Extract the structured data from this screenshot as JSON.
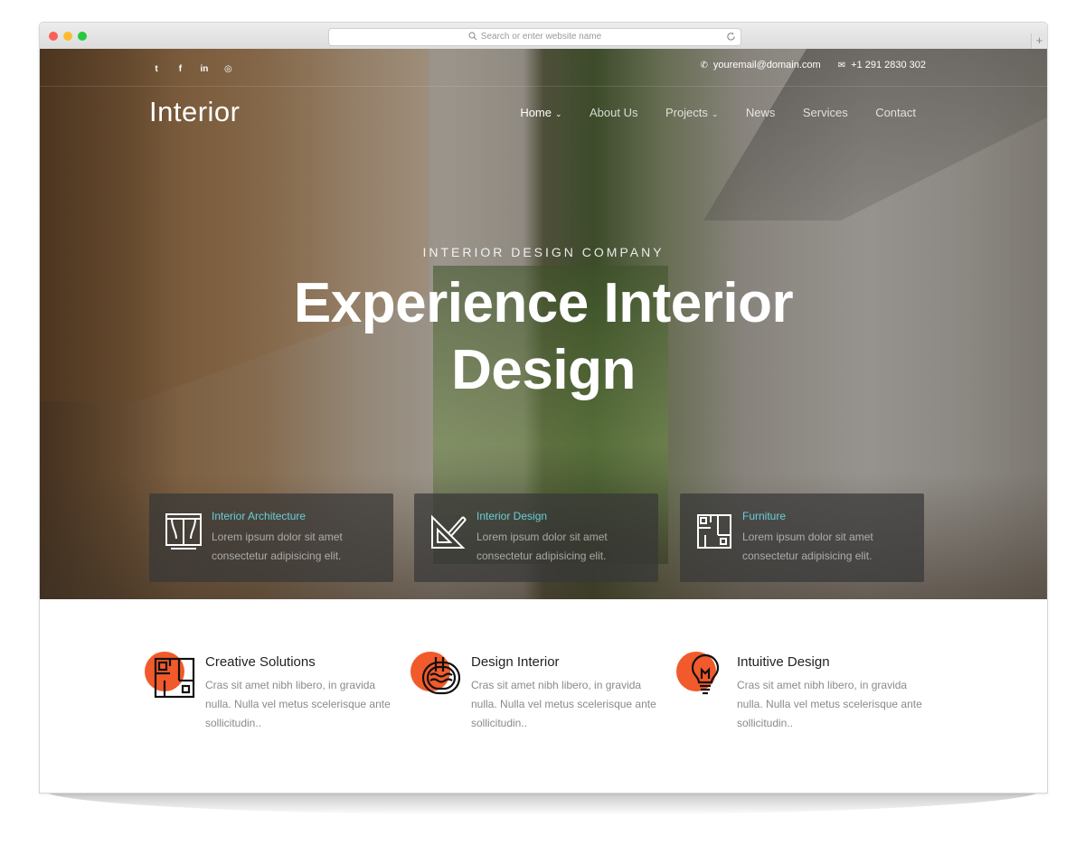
{
  "browser": {
    "address_placeholder": "Search or enter website name",
    "new_tab_label": "+"
  },
  "topbar": {
    "social": [
      {
        "icon": "twitter-icon",
        "glyph": "t"
      },
      {
        "icon": "facebook-icon",
        "glyph": "f"
      },
      {
        "icon": "linkedin-icon",
        "glyph": "in"
      },
      {
        "icon": "instagram-icon",
        "glyph": "◎"
      }
    ],
    "email": "youremail@domain.com",
    "phone": "+1 291 2830 302"
  },
  "header": {
    "logo": "Interior",
    "nav": [
      {
        "label": "Home",
        "dropdown": true,
        "active": true
      },
      {
        "label": "About Us",
        "dropdown": false,
        "active": false
      },
      {
        "label": "Projects",
        "dropdown": true,
        "active": false
      },
      {
        "label": "News",
        "dropdown": false,
        "active": false
      },
      {
        "label": "Services",
        "dropdown": false,
        "active": false
      },
      {
        "label": "Contact",
        "dropdown": false,
        "active": false
      }
    ]
  },
  "hero": {
    "subtitle": "INTERIOR DESIGN COMPANY",
    "title": "Experience Interior Design"
  },
  "features": [
    {
      "icon": "window-icon",
      "title": "Interior Architecture",
      "desc": "Lorem ipsum dolor sit amet consectetur adipisicing elit."
    },
    {
      "icon": "ruler-triangle-icon",
      "title": "Interior Design",
      "desc": "Lorem ipsum dolor sit amet consectetur adipisicing elit."
    },
    {
      "icon": "floor-plan-icon",
      "title": "Furniture",
      "desc": "Lorem ipsum dolor sit amet consectetur adipisicing elit."
    }
  ],
  "services": [
    {
      "icon": "floor-plan-icon",
      "title": "Creative Solutions",
      "desc": "Cras sit amet nibh libero, in gravida nulla. Nulla vel metus scelerisque ante sollicitudin.."
    },
    {
      "icon": "pool-icon",
      "title": "Design Interior",
      "desc": "Cras sit amet nibh libero, in gravida nulla. Nulla vel metus scelerisque ante sollicitudin.."
    },
    {
      "icon": "lightbulb-icon",
      "title": "Intuitive Design",
      "desc": "Cras sit amet nibh libero, in gravida nulla. Nulla vel metus scelerisque ante sollicitudin.."
    }
  ],
  "colors": {
    "accent": "#f15a2b",
    "feature_title": "#69cfd5"
  }
}
